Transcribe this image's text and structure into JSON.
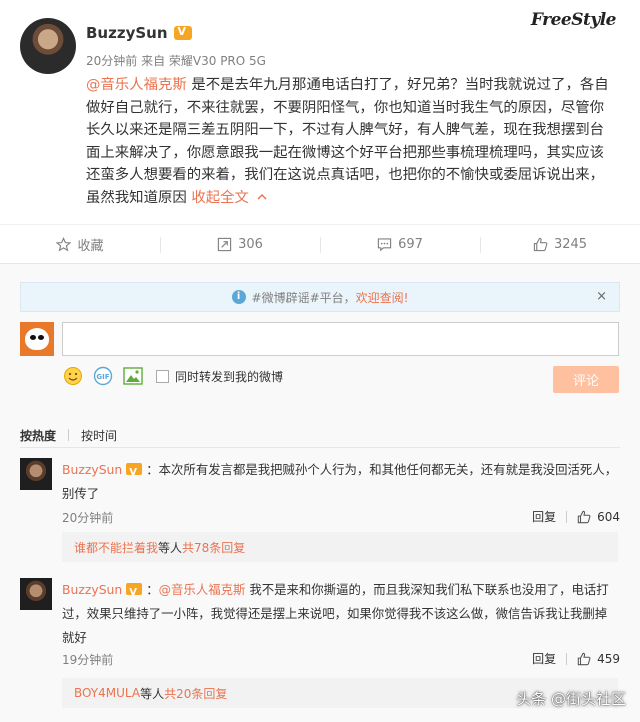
{
  "post": {
    "author": "BuzzySun",
    "brand_logo": "FreeStyle",
    "meta": "20分钟前 来自 荣耀V30 PRO 5G",
    "mention": "@音乐人福克斯",
    "text": " 是不是去年九月那通电话白打了，好兄弟？当时我就说过了，各自做好自己就行，不来往就罢，不要阴阳怪气，你也知道当时我生气的原因，尽管你长久以来还是隔三差五阴阳一下，不过有人脾气好，有人脾气差，现在我想摆到台面上来解决了，你愿意跟我一起在微博这个好平台把那些事梳理梳理吗，其实应该还蛮多人想要看的来着，我们在这说点真话吧，也把你的不愉快或委屈诉说出来，虽然我知道原因",
    "collapse_label": "收起全文"
  },
  "actions": {
    "favorite": "收藏",
    "repost_count": "306",
    "comment_count": "697",
    "like_count": "3245"
  },
  "rumor_bar": {
    "tag": "#微博辟谣#平台，",
    "link": "欢迎查阅!",
    "close": "×"
  },
  "composer": {
    "repost_label": "同时转发到我的微博",
    "submit_label": "评论"
  },
  "sort": {
    "by_hot": "按热度",
    "by_time": "按时间"
  },
  "comments": [
    {
      "name": "BuzzySun",
      "text": "：本次所有发言都是我把贼孙个人行为，和其他任何都无关，还有就是我没回活死人，别传了",
      "time": "20分钟前",
      "reply": "回复",
      "likes": "604",
      "reply_summary_users": "谁都不能拦着我",
      "reply_summary_middle": " 等人 ",
      "reply_summary_count": "共78条回复"
    },
    {
      "name": "BuzzySun",
      "mention": "@音乐人福克斯",
      "text": " 我不是来和你撕逼的，而且我深知我们私下联系也没用了，电话打过，效果只维持了一小阵，我觉得还是摆上来说吧，如果你觉得我不该这么做，微信告诉我让我删掉就好",
      "time": "19分钟前",
      "reply": "回复",
      "likes": "459",
      "reply_summary_users": "BOY4MULA",
      "reply_summary_middle": " 等人 ",
      "reply_summary_count": "共20条回复"
    }
  ],
  "watermark": "头条 @街头社区"
}
